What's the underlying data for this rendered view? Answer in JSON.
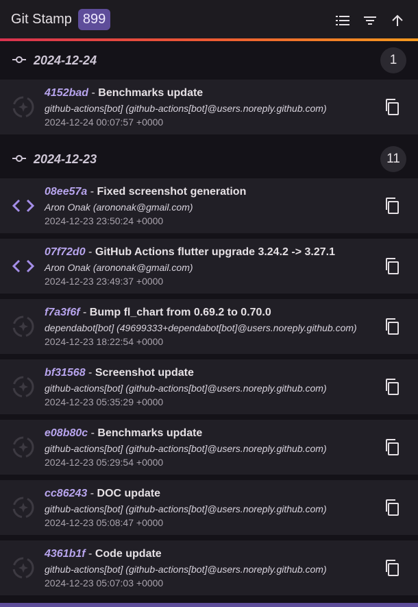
{
  "appbar": {
    "title": "Git Stamp",
    "count": "899",
    "actions": [
      {
        "name": "list-icon"
      },
      {
        "name": "filter-icon"
      },
      {
        "name": "arrow-up-icon"
      }
    ]
  },
  "colors": {
    "accent_hash": "#b8a5ee",
    "badge_bg": "#5e4d9a",
    "icon_purple": "#a48ee8",
    "gradient": [
      "#d9324f",
      "#ee5a33",
      "#f59a1e"
    ]
  },
  "groups": [
    {
      "date": "2024-12-24",
      "count": "1",
      "commits": [
        {
          "hash": "4152bad",
          "message": "Benchmarks update",
          "author": "github-actions[bot] (github-actions[bot]@users.noreply.github.com)",
          "datetime": "2024-12-24 00:07:57 +0000",
          "icon": "bot-icon"
        }
      ]
    },
    {
      "date": "2024-12-23",
      "count": "11",
      "commits": [
        {
          "hash": "08ee57a",
          "message": "Fixed screenshot generation",
          "author": "Aron Onak (arononak@gmail.com)",
          "datetime": "2024-12-23 23:50:24 +0000",
          "icon": "code-icon"
        },
        {
          "hash": "07f72d0",
          "message": "GitHub Actions flutter upgrade 3.24.2 -> 3.27.1",
          "author": "Aron Onak (arononak@gmail.com)",
          "datetime": "2024-12-23 23:49:37 +0000",
          "icon": "code-icon"
        },
        {
          "hash": "f7a3f6f",
          "message": "Bump fl_chart from 0.69.2 to 0.70.0",
          "author": "dependabot[bot] (49699333+dependabot[bot]@users.noreply.github.com)",
          "datetime": "2024-12-23 18:22:54 +0000",
          "icon": "bot-icon"
        },
        {
          "hash": "bf31568",
          "message": "Screenshot update",
          "author": "github-actions[bot] (github-actions[bot]@users.noreply.github.com)",
          "datetime": "2024-12-23 05:35:29 +0000",
          "icon": "bot-icon"
        },
        {
          "hash": "e08b80c",
          "message": "Benchmarks update",
          "author": "github-actions[bot] (github-actions[bot]@users.noreply.github.com)",
          "datetime": "2024-12-23 05:29:54 +0000",
          "icon": "bot-icon"
        },
        {
          "hash": "cc86243",
          "message": "DOC update",
          "author": "github-actions[bot] (github-actions[bot]@users.noreply.github.com)",
          "datetime": "2024-12-23 05:08:47 +0000",
          "icon": "bot-icon"
        },
        {
          "hash": "4361b1f",
          "message": "Code update",
          "author": "github-actions[bot] (github-actions[bot]@users.noreply.github.com)",
          "datetime": "2024-12-23 05:07:03 +0000",
          "icon": "bot-icon"
        }
      ]
    }
  ]
}
